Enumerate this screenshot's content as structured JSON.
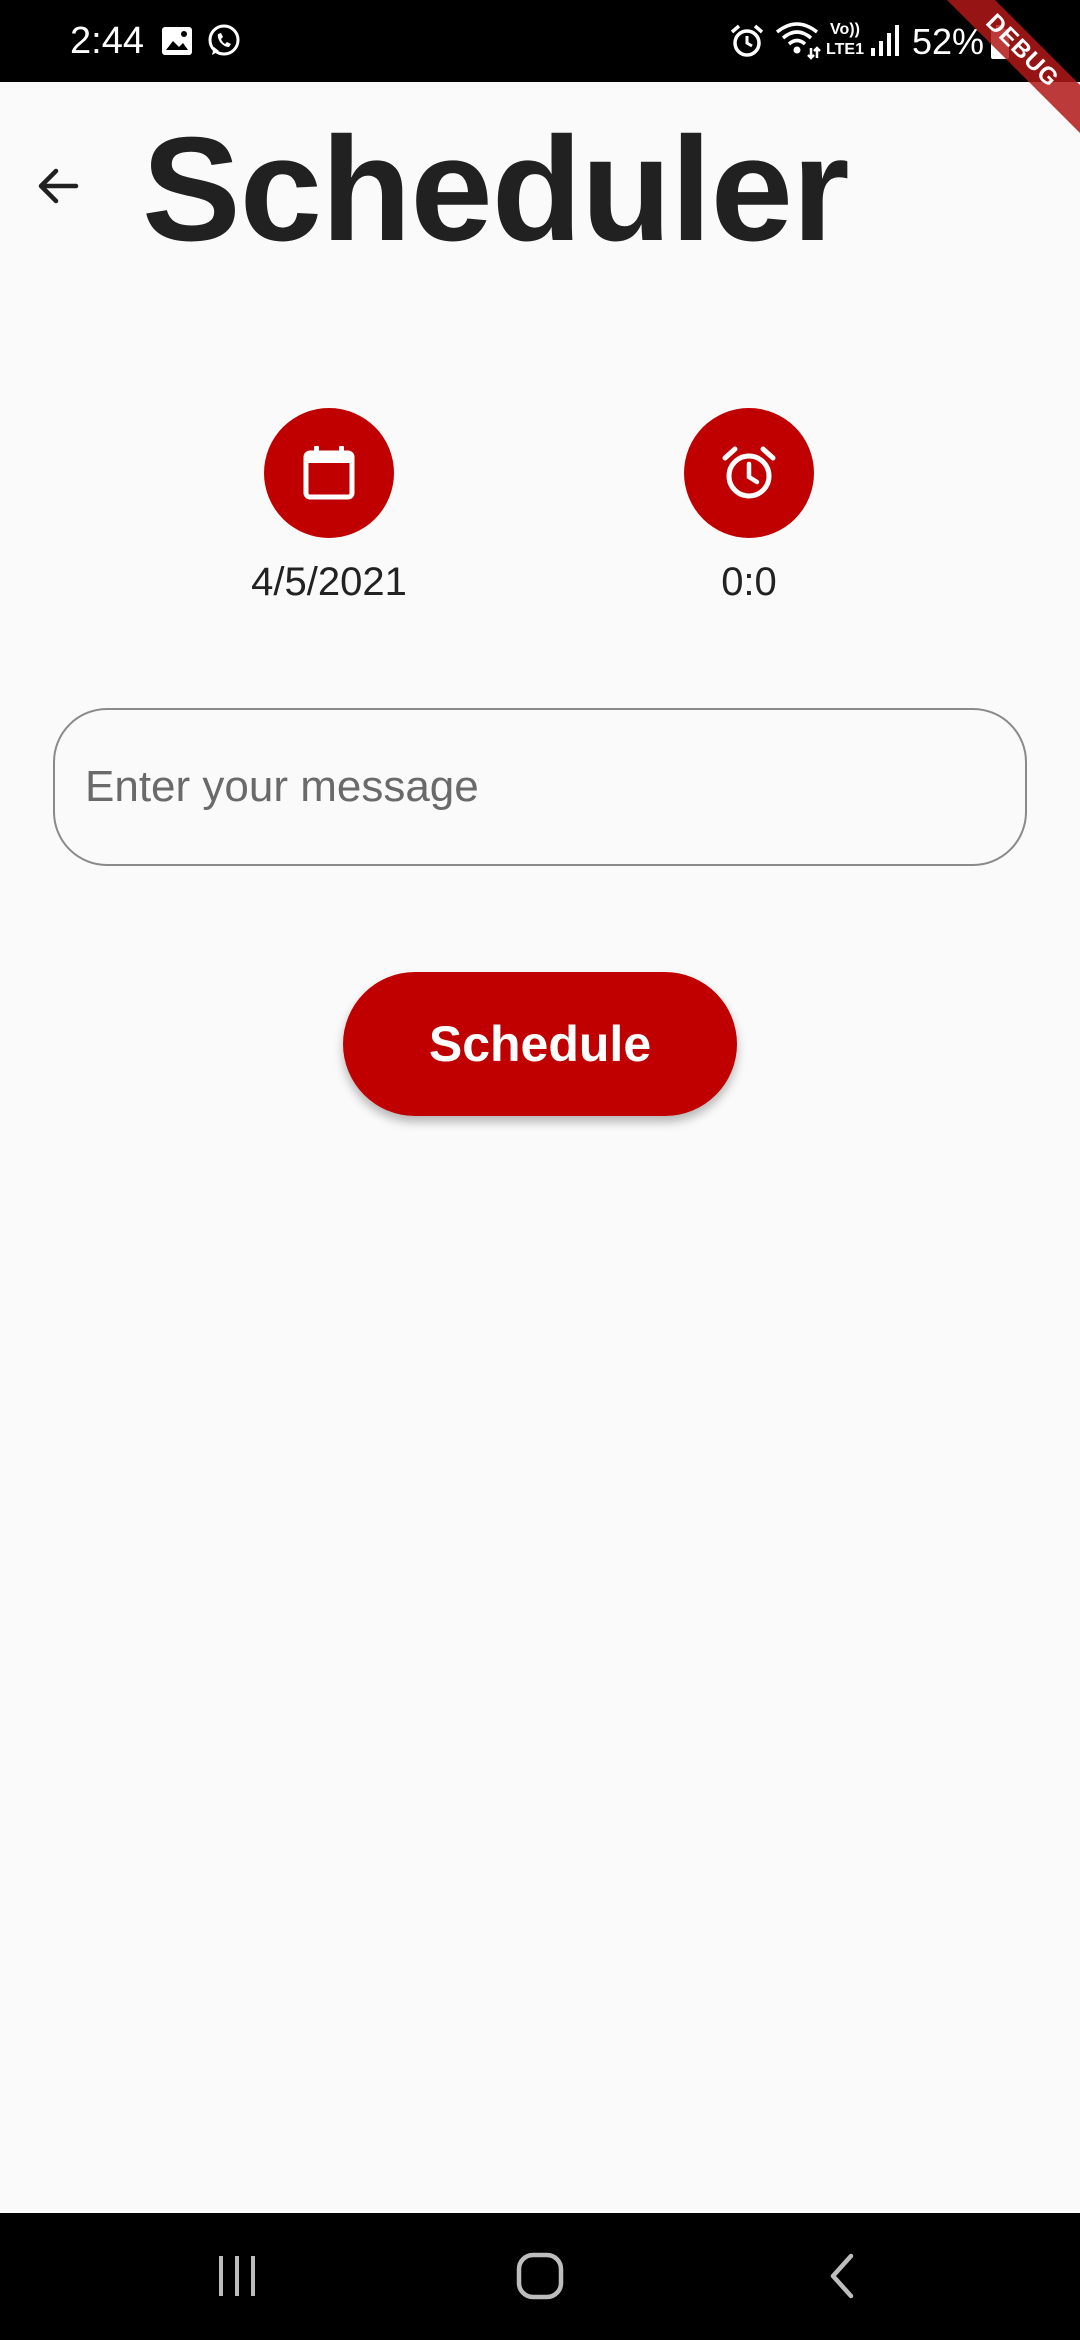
{
  "status_bar": {
    "time": "2:44",
    "battery": "52%",
    "icons": [
      "gallery-icon",
      "whatsapp-icon",
      "alarm-icon",
      "wifi-icon",
      "volte-lte-icon",
      "signal-icon",
      "battery-icon"
    ],
    "volte_top": "Vo))",
    "volte_bottom": "LTE1"
  },
  "debug_banner": "DEBUG",
  "app_bar": {
    "back_icon": "arrow-back-icon",
    "title": "Scheduler"
  },
  "pickers": {
    "date": {
      "icon": "calendar-icon",
      "value": "4/5/2021"
    },
    "time": {
      "icon": "alarm-clock-icon",
      "value": "0:0"
    }
  },
  "message": {
    "placeholder": "Enter your message",
    "value": ""
  },
  "schedule_button": {
    "label": "Schedule"
  },
  "nav_bar": {
    "icons": [
      "recent-apps-icon",
      "home-icon",
      "back-nav-icon"
    ]
  },
  "colors": {
    "accent": "#c00000",
    "background": "#fafafa",
    "text": "#212121"
  }
}
